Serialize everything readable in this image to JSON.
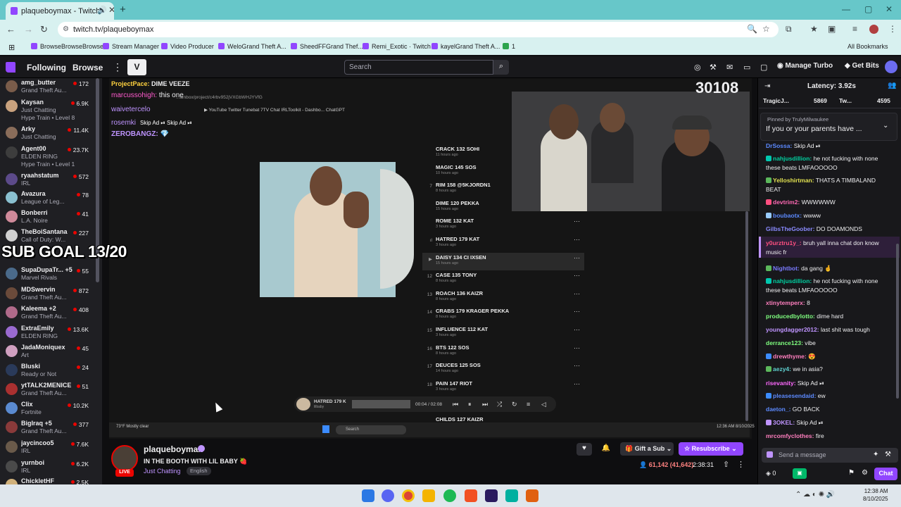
{
  "browser": {
    "tab_title": "plaqueboymax - Twitch",
    "url": "twitch.tv/plaqueboymax",
    "bookmarks": [
      "BrowseBrowseBrowse",
      "Stream Manager",
      "Video Producer",
      "WeloGrand Theft A...",
      "SheedFFGrand Thef...",
      "Remi_Exotic · Twitch",
      "kayelGrand Theft A...",
      "1",
      "All Bookmarks"
    ]
  },
  "twitch_nav": {
    "following": "Following",
    "browse": "Browse",
    "search_placeholder": "Search",
    "manage_turbo": "Manage Turbo",
    "get_bits": "Get Bits"
  },
  "sidebar": {
    "channels": [
      {
        "name": "amg_butter",
        "game": "Grand Theft Au...",
        "viewers": "172",
        "color": "#7a5c4a"
      },
      {
        "name": "Kaysan",
        "game": "Just Chatting",
        "viewers": "6.9K",
        "hype": "Hype Train • Level 8",
        "color": "#c9a27e"
      },
      {
        "name": "Arky",
        "game": "Just Chatting",
        "viewers": "11.4K",
        "color": "#8a6d5a"
      },
      {
        "name": "Agent00",
        "game": "ELDEN RING",
        "viewers": "23.7K",
        "hype": "Hype Train • Level 1",
        "color": "#3d3d3d"
      },
      {
        "name": "ryaahstatum",
        "game": "IRL",
        "viewers": "572",
        "color": "#5c4a8a"
      },
      {
        "name": "Avazura",
        "game": "League of Leg...",
        "viewers": "78",
        "color": "#8ac0d0"
      },
      {
        "name": "Bonberri",
        "game": "L.A. Noire",
        "viewers": "41",
        "color": "#d08a9a"
      },
      {
        "name": "TheBoiSantana",
        "game": "Call of Duty: W...",
        "viewers": "227",
        "color": "#d0d0d0"
      },
      {
        "name": "SupaDupaTr... +5",
        "game": "Marvel Rivals",
        "viewers": "55",
        "color": "#4a6a8a"
      },
      {
        "name": "MDSwervin",
        "game": "Grand Theft Au...",
        "viewers": "872",
        "color": "#6a4a3a"
      },
      {
        "name": "Kaleema +2",
        "game": "Grand Theft Au...",
        "viewers": "408",
        "color": "#b06a8a"
      },
      {
        "name": "ExtraEmily",
        "game": "ELDEN RING",
        "viewers": "13.6K",
        "color": "#9a6ad0"
      },
      {
        "name": "JadaMoniquex",
        "game": "Art",
        "viewers": "45",
        "color": "#d0a0c0"
      },
      {
        "name": "Bluski",
        "game": "Ready or Not",
        "viewers": "24",
        "color": "#2a3a5a"
      },
      {
        "name": "ytTALK2MENICE",
        "game": "Grand Theft Au...",
        "viewers": "51",
        "color": "#aa3030"
      },
      {
        "name": "Clix",
        "game": "Fortnite",
        "viewers": "10.2K",
        "color": "#5a8ad0"
      },
      {
        "name": "BigIraq +5",
        "game": "Grand Theft Au...",
        "viewers": "377",
        "color": "#8a3a3a"
      },
      {
        "name": "jaycincoo5",
        "game": "IRL",
        "viewers": "7.6K",
        "color": "#6a5a4a"
      },
      {
        "name": "yurnboi",
        "game": "IRL",
        "viewers": "6.2K",
        "color": "#4a4a4a"
      },
      {
        "name": "ChickletHF",
        "game": "",
        "viewers": "2.5K",
        "color": "#d0b07a"
      }
    ]
  },
  "player": {
    "overlay_progress_label": "ProjectPace:",
    "overlay_progress_value": "DIME VEEZE",
    "overlay_chat": [
      {
        "user": "marcussohigh:",
        "text": "this one"
      },
      {
        "user": "waivetercelo",
        "text": ""
      },
      {
        "user": "rosemki",
        "text": "Skip Ad ⏯  Skip Ad ⏯"
      },
      {
        "user": "ZEROBANGZ:",
        "text": "💎"
      }
    ],
    "inner_bookmarks": "▶ YouTube   Twitter   Tunebat   7TV Chat   IRLToolkit - Dashbo...   ChatGPT",
    "inner_url": "...ainbox/project/c4rbv952jVXGbWHJYVfG",
    "counter": "30108",
    "sub_goal": "SUB GOAL 13/20",
    "tracks": [
      {
        "num": "",
        "title": "CRACK 132 SOHI",
        "sub": "11 hours ago"
      },
      {
        "num": "",
        "title": "MAGIC 145 SOS",
        "sub": "10 hours ago"
      },
      {
        "num": "7",
        "title": "RIM 158 @5KJORDN1",
        "sub": "8 hours ago"
      },
      {
        "num": "",
        "title": "DIME 120 PEKKA",
        "sub": "15 hours ago"
      },
      {
        "num": "",
        "title": "ROME 132 KAT",
        "sub": "3 hours ago"
      },
      {
        "num": "",
        "title": "HATRED 179 KAT",
        "sub": "3 hours ago"
      },
      {
        "num": "▶",
        "title": "DAISY 134 CI IXSEN",
        "sub": "15 hours ago"
      },
      {
        "num": "12",
        "title": "CASE 135 TONY",
        "sub": "8 hours ago"
      },
      {
        "num": "13",
        "title": "ROACH 136 KAIZR",
        "sub": "8 hours ago"
      },
      {
        "num": "14",
        "title": "CRABS 179 KRAGER PEKKA",
        "sub": "8 hours ago"
      },
      {
        "num": "15",
        "title": "INFLUENCE 112 KAT",
        "sub": "3 hours ago"
      },
      {
        "num": "16",
        "title": "BTS 122 SOS",
        "sub": "8 hours ago"
      },
      {
        "num": "17",
        "title": "DEUCES 125 SOS",
        "sub": "14 hours ago"
      },
      {
        "num": "18",
        "title": "PAIN 147 RIOT",
        "sub": "3 hours ago"
      },
      {
        "num": "",
        "title": "CHILDS 127 KAIZR",
        "sub": ""
      }
    ],
    "mini_player": {
      "title": "HATRED 179 K",
      "artist": "lilbaby",
      "time": "00:04 / 02:08"
    },
    "inner_taskbar": {
      "weather": "73°F Mostly clear",
      "search": "Search",
      "time": "12:36 AM 8/10/2025"
    }
  },
  "channel": {
    "name": "plaqueboymax",
    "title": "IN THE BOOTH WITH LIL BABY 🍓",
    "category": "Just Chatting",
    "language": "English",
    "live": "LIVE",
    "gift_label": "Gift a Sub",
    "resub_label": "Resubscribe",
    "viewers": "61,142 (41,642)",
    "uptime": "2:38:31"
  },
  "chat": {
    "latency": "Latency: 3.92s",
    "leaderboard": [
      {
        "name": "TragicJ...",
        "value": ""
      },
      {
        "name": "",
        "value": "5869"
      },
      {
        "name": "Tw...",
        "value": "4595"
      }
    ],
    "pinned_by": "Pinned by TrulyMilwaukee",
    "pinned_message": "If you or your parents have ...",
    "messages": [
      {
        "user": "DrSossa:",
        "text": "Skip Ad ⏯",
        "color": "#5c8aff"
      },
      {
        "user": "nahjusdillion:",
        "text": "he not fucking with none these beats LMFAOOOOO",
        "color": "#00d0a0"
      },
      {
        "user": "Yelloshirtman:",
        "text": "THATS A TIMBALAND BEAT",
        "color": "#e0e050"
      },
      {
        "user": "devtrim2:",
        "text": "WWWWWW",
        "color": "#ff69b4"
      },
      {
        "user": "boubaotx:",
        "text": "wwww",
        "color": "#5c8aff"
      },
      {
        "user": "GilbsTheGoober:",
        "text": "DO DOAMONDS",
        "color": "#8a8aff"
      },
      {
        "user": "y0urztru1y_:",
        "text": "bruh yall inna chat don know music fr",
        "color": "#ff4f80"
      },
      {
        "user": "Nightbot:",
        "text": "da gang 🤞",
        "color": "#7a7aff"
      },
      {
        "user": "nahjusdillion:",
        "text": "he not fucking with none these beats LMFAOOOOO",
        "color": "#00d0a0"
      },
      {
        "user": "xtinytemperx:",
        "text": "8",
        "color": "#ff7fbf"
      },
      {
        "user": "producedbylotto:",
        "text": "dime hard",
        "color": "#7fff7f"
      },
      {
        "user": "youngdagger2012:",
        "text": "last shit was tough",
        "color": "#bf94ff"
      },
      {
        "user": "derrance123:",
        "text": "vibe",
        "color": "#7fff7f"
      },
      {
        "user": "drewthyme:",
        "text": "😍",
        "color": "#ff7fbf"
      },
      {
        "user": "aezy4:",
        "text": "we in asia?",
        "color": "#5fd0d0"
      },
      {
        "user": "risevanity:",
        "text": "Skip Ad ⏯",
        "color": "#ff69ff"
      },
      {
        "user": "pleasesendaid:",
        "text": "ew",
        "color": "#5c8aff"
      },
      {
        "user": "daeton_:",
        "text": "GO BACK",
        "color": "#5c8aff"
      },
      {
        "user": "3OKEL:",
        "text": "Skip Ad ⏯",
        "color": "#bf94ff"
      },
      {
        "user": "mrcomfyclothes:",
        "text": "fire",
        "color": "#ff7fbf"
      }
    ],
    "input_placeholder": "Send a message",
    "points": "0",
    "chat_button": "Chat"
  },
  "os": {
    "clock_time": "12:38 AM",
    "clock_date": "8/10/2025"
  }
}
